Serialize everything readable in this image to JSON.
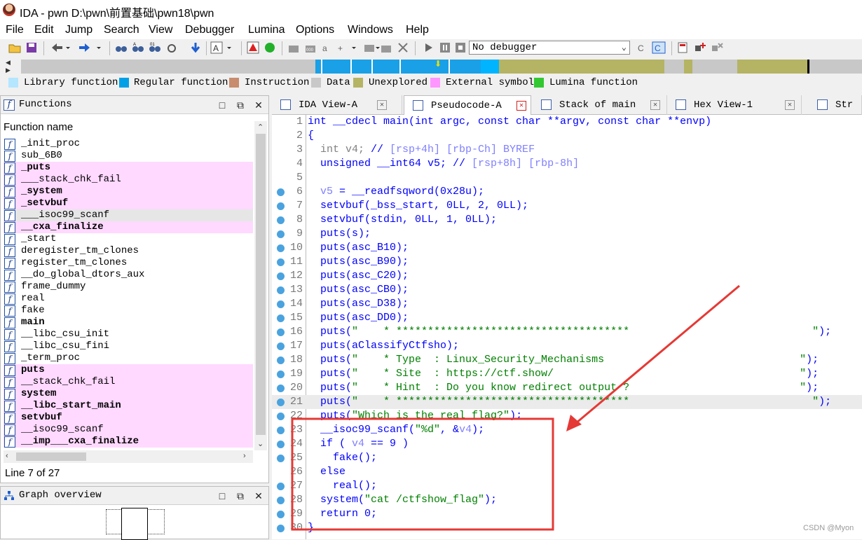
{
  "title": "IDA - pwn D:\\pwn\\前置基础\\pwn18\\pwn",
  "menu": [
    "File",
    "Edit",
    "Jump",
    "Search",
    "View",
    "Debugger",
    "Lumina",
    "Options",
    "Windows",
    "Help"
  ],
  "toolbar": {
    "debugger_value": "No debugger"
  },
  "legend": [
    {
      "label": "Library function",
      "color": "#b4e6ff"
    },
    {
      "label": "Regular function",
      "color": "#00a0e6"
    },
    {
      "label": "Instruction",
      "color": "#c88c6e"
    },
    {
      "label": "Data",
      "color": "#c8c8c8"
    },
    {
      "label": "Unexplored",
      "color": "#b4b464"
    },
    {
      "label": "External symbol",
      "color": "#ff96ff"
    },
    {
      "label": "Lumina function",
      "color": "#32c832"
    }
  ],
  "functions_panel": {
    "title": "Functions",
    "column_header": "Function name",
    "status": "Line 7 of 27",
    "items": [
      {
        "name": "_init_proc",
        "kind": "normal"
      },
      {
        "name": "sub_6B0",
        "kind": "normal"
      },
      {
        "name": "_puts",
        "kind": "lib-bold"
      },
      {
        "name": "___stack_chk_fail",
        "kind": "lib"
      },
      {
        "name": "_system",
        "kind": "lib-bold"
      },
      {
        "name": "_setvbuf",
        "kind": "lib-bold"
      },
      {
        "name": "___isoc99_scanf",
        "kind": "selected"
      },
      {
        "name": "__cxa_finalize",
        "kind": "lib-bold"
      },
      {
        "name": "_start",
        "kind": "normal"
      },
      {
        "name": "deregister_tm_clones",
        "kind": "normal"
      },
      {
        "name": "register_tm_clones",
        "kind": "normal"
      },
      {
        "name": "__do_global_dtors_aux",
        "kind": "normal"
      },
      {
        "name": "frame_dummy",
        "kind": "normal"
      },
      {
        "name": "real",
        "kind": "normal"
      },
      {
        "name": "fake",
        "kind": "normal"
      },
      {
        "name": "main",
        "kind": "bold"
      },
      {
        "name": "__libc_csu_init",
        "kind": "normal"
      },
      {
        "name": "__libc_csu_fini",
        "kind": "normal"
      },
      {
        "name": "_term_proc",
        "kind": "normal"
      },
      {
        "name": "puts",
        "kind": "lib-bold"
      },
      {
        "name": "__stack_chk_fail",
        "kind": "lib"
      },
      {
        "name": "system",
        "kind": "lib-bold"
      },
      {
        "name": "__libc_start_main",
        "kind": "lib-bold"
      },
      {
        "name": "setvbuf",
        "kind": "lib-bold"
      },
      {
        "name": "__isoc99_scanf",
        "kind": "lib"
      },
      {
        "name": "__imp___cxa_finalize",
        "kind": "lib-bold"
      }
    ]
  },
  "graph_panel": {
    "title": "Graph overview"
  },
  "tabs": [
    {
      "label": "IDA View-A",
      "active": false
    },
    {
      "label": "Pseudocode-A",
      "active": true
    },
    {
      "label": "Stack of main",
      "active": false
    },
    {
      "label": "Hex View-1",
      "active": false
    },
    {
      "label": "Str",
      "active": false
    }
  ],
  "code": [
    {
      "n": "1",
      "bp": false,
      "hl": false,
      "parts": [
        [
          "c-cmt",
          "int __cdecl main(int argc, const char **argv, const char **envp)"
        ]
      ]
    },
    {
      "n": "2",
      "bp": false,
      "hl": false,
      "parts": [
        [
          "c-cmt",
          "{"
        ]
      ]
    },
    {
      "n": "3",
      "bp": false,
      "hl": false,
      "parts": [
        [
          "c-gray",
          "  int v4; "
        ],
        [
          "c-cmt",
          "// "
        ],
        [
          "c-mag",
          "[rsp+4h] [rbp-Ch] BYREF"
        ]
      ]
    },
    {
      "n": "4",
      "bp": false,
      "hl": false,
      "parts": [
        [
          "c-cmt",
          "  unsigned __int64 v5; // "
        ],
        [
          "c-mag",
          "[rsp+8h] [rbp-8h]"
        ]
      ]
    },
    {
      "n": "5",
      "bp": false,
      "hl": false,
      "parts": [
        [
          "c-cmt",
          ""
        ]
      ]
    },
    {
      "n": "6",
      "bp": true,
      "hl": false,
      "parts": [
        [
          "c-mag",
          "  v5"
        ],
        [
          "c-cmt",
          " = __readfsqword(0x28u);"
        ]
      ]
    },
    {
      "n": "7",
      "bp": true,
      "hl": false,
      "parts": [
        [
          "c-cmt",
          "  setvbuf(_bss_start, 0LL, 2, 0LL);"
        ]
      ]
    },
    {
      "n": "8",
      "bp": true,
      "hl": false,
      "parts": [
        [
          "c-cmt",
          "  setvbuf(stdin, 0LL, 1, 0LL);"
        ]
      ]
    },
    {
      "n": "9",
      "bp": true,
      "hl": false,
      "parts": [
        [
          "c-cmt",
          "  puts(s);"
        ]
      ]
    },
    {
      "n": "10",
      "bp": true,
      "hl": false,
      "parts": [
        [
          "c-cmt",
          "  puts(asc_B10);"
        ]
      ]
    },
    {
      "n": "11",
      "bp": true,
      "hl": false,
      "parts": [
        [
          "c-cmt",
          "  puts(asc_B90);"
        ]
      ]
    },
    {
      "n": "12",
      "bp": true,
      "hl": false,
      "parts": [
        [
          "c-cmt",
          "  puts(asc_C20);"
        ]
      ]
    },
    {
      "n": "13",
      "bp": true,
      "hl": false,
      "parts": [
        [
          "c-cmt",
          "  puts(asc_CB0);"
        ]
      ]
    },
    {
      "n": "14",
      "bp": true,
      "hl": false,
      "parts": [
        [
          "c-cmt",
          "  puts(asc_D38);"
        ]
      ]
    },
    {
      "n": "15",
      "bp": true,
      "hl": false,
      "parts": [
        [
          "c-cmt",
          "  puts(asc_DD0);"
        ]
      ]
    },
    {
      "n": "16",
      "bp": true,
      "hl": false,
      "parts": [
        [
          "c-cmt",
          "  puts("
        ],
        [
          "c-green",
          "\"    * *************************************                             \""
        ],
        [
          "c-cmt",
          ");"
        ]
      ]
    },
    {
      "n": "17",
      "bp": true,
      "hl": false,
      "parts": [
        [
          "c-cmt",
          "  puts(aClassifyCtfsho);"
        ]
      ]
    },
    {
      "n": "18",
      "bp": true,
      "hl": false,
      "parts": [
        [
          "c-cmt",
          "  puts("
        ],
        [
          "c-green",
          "\"    * Type  : Linux_Security_Mechanisms                               \""
        ],
        [
          "c-cmt",
          ");"
        ]
      ]
    },
    {
      "n": "19",
      "bp": true,
      "hl": false,
      "parts": [
        [
          "c-cmt",
          "  puts("
        ],
        [
          "c-green",
          "\"    * Site  : https://ctf.show/                                       \""
        ],
        [
          "c-cmt",
          ");"
        ]
      ]
    },
    {
      "n": "20",
      "bp": true,
      "hl": false,
      "parts": [
        [
          "c-cmt",
          "  puts("
        ],
        [
          "c-green",
          "\"    * Hint  : Do you know redirect output ?                           \""
        ],
        [
          "c-cmt",
          ");"
        ]
      ]
    },
    {
      "n": "21",
      "bp": true,
      "hl": true,
      "parts": [
        [
          "c-cmt",
          "  puts("
        ],
        [
          "c-green",
          "\"    * *************************************                             \""
        ],
        [
          "c-cmt",
          ");"
        ]
      ]
    },
    {
      "n": "22",
      "bp": true,
      "hl": false,
      "parts": [
        [
          "c-cmt",
          "  puts("
        ],
        [
          "c-green",
          "\"Which is the real flag?\""
        ],
        [
          "c-cmt",
          ");"
        ]
      ]
    },
    {
      "n": "23",
      "bp": true,
      "hl": false,
      "parts": [
        [
          "c-cmt",
          "  __isoc99_scanf("
        ],
        [
          "c-green",
          "\"%d\""
        ],
        [
          "c-cmt",
          ", &"
        ],
        [
          "c-mag",
          "v4"
        ],
        [
          "c-cmt",
          ");"
        ]
      ]
    },
    {
      "n": "24",
      "bp": true,
      "hl": false,
      "parts": [
        [
          "c-cmt",
          "  if ( "
        ],
        [
          "c-mag",
          "v4"
        ],
        [
          "c-cmt",
          " == 9 )"
        ]
      ]
    },
    {
      "n": "25",
      "bp": true,
      "hl": false,
      "parts": [
        [
          "c-cmt",
          "    fake();"
        ]
      ]
    },
    {
      "n": "26",
      "bp": false,
      "hl": false,
      "parts": [
        [
          "c-cmt",
          "  else"
        ]
      ]
    },
    {
      "n": "27",
      "bp": true,
      "hl": false,
      "parts": [
        [
          "c-cmt",
          "    real();"
        ]
      ]
    },
    {
      "n": "28",
      "bp": true,
      "hl": false,
      "parts": [
        [
          "c-cmt",
          "  system("
        ],
        [
          "c-green",
          "\"cat /ctfshow_flag\""
        ],
        [
          "c-cmt",
          ");"
        ]
      ]
    },
    {
      "n": "29",
      "bp": true,
      "hl": false,
      "parts": [
        [
          "c-cmt",
          "  return 0;"
        ]
      ]
    },
    {
      "n": "30",
      "bp": true,
      "hl": false,
      "parts": [
        [
          "c-cmt",
          "}"
        ]
      ]
    }
  ],
  "annotation": {
    "color": "#e53935"
  },
  "watermark": "CSDN @Myon⁠"
}
